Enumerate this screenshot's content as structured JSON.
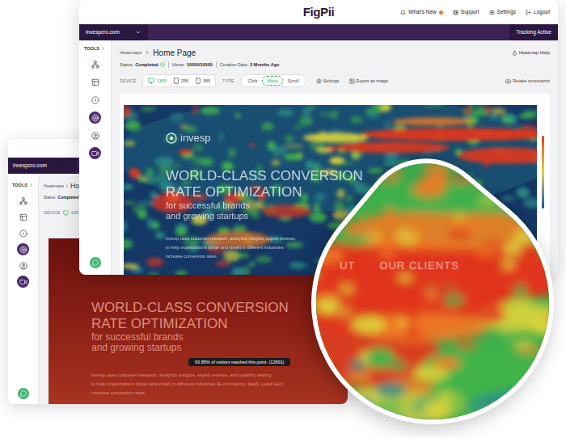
{
  "front_window": {
    "logo": "FigPii",
    "nav": [
      {
        "label": "What's New",
        "badge": true
      },
      {
        "label": "Support",
        "badge": false
      },
      {
        "label": "Settings",
        "badge": false
      },
      {
        "label": "Logout",
        "badge": false
      }
    ],
    "site": "invespcro.com",
    "tracking": "Tracking Active",
    "tools_label": "TOOLS",
    "tools": [
      {
        "filled": false
      },
      {
        "filled": false
      },
      {
        "filled": false
      },
      {
        "filled": true
      },
      {
        "filled": false
      },
      {
        "filled": true
      }
    ],
    "breadcrumb": {
      "parent": "Heatmaps",
      "current": "Home Page"
    },
    "help": "Heatmap Help",
    "status": [
      {
        "label": "Status:",
        "value": "Completed",
        "check": true
      },
      {
        "label": "Views:",
        "value": "10000/10000",
        "check": false
      },
      {
        "label": "Creation Date:",
        "value": "2 Months Ago",
        "check": false
      }
    ],
    "device_label": "DEVICE",
    "devices": [
      {
        "count": "1365",
        "selected": true
      },
      {
        "count": "256",
        "selected": false
      },
      {
        "count": "365",
        "selected": false
      }
    ],
    "type_label": "TYPE",
    "types": [
      {
        "label": "Click",
        "selected": false
      },
      {
        "label": "Move",
        "selected": true
      },
      {
        "label": "Scroll",
        "selected": false
      }
    ],
    "actions": [
      "Settings",
      "Export as image"
    ],
    "retake": "Retake screenshot",
    "page": {
      "logo": "invesp",
      "headline": [
        "WORLD-CLASS CONVERSION",
        "RATE OPTIMIZATION"
      ],
      "tagline": [
        "for successful brands",
        "and growing startups"
      ],
      "body": [
        "Invesp uses customer research, analytics insights, expert reviews,",
        "to help organizations (large and small) in different industries",
        "increase conversion rates."
      ]
    }
  },
  "back_window": {
    "site": "invespcro.com",
    "tools_label": "TOOLS",
    "tools": [
      {
        "filled": false
      },
      {
        "filled": false
      },
      {
        "filled": false
      },
      {
        "filled": true
      },
      {
        "filled": false
      },
      {
        "filled": true
      }
    ],
    "breadcrumb": {
      "parent": "Heatmaps",
      "current": "Ho"
    },
    "status": {
      "label": "Status:",
      "value": "Completed"
    },
    "device_label": "DEVICE",
    "device_count": "136",
    "page": {
      "headline": [
        "WORLD-CLASS CONVERSION",
        "RATE OPTIMIZATION"
      ],
      "tagline": [
        "for successful brands",
        "and growing startups"
      ],
      "body": [
        "Invesp uses customer research, analytics insights, expert reviews, and usability testing",
        "to help organizations (large and small) in different industries (E-commerce, SaaS, Lead Gen)",
        "increase conversion rates."
      ]
    },
    "tooltip": "93.85% of visitors reached this point. (12891)"
  },
  "magnifier": {
    "texts": [
      "UT",
      "OUR CLIENTS"
    ]
  }
}
